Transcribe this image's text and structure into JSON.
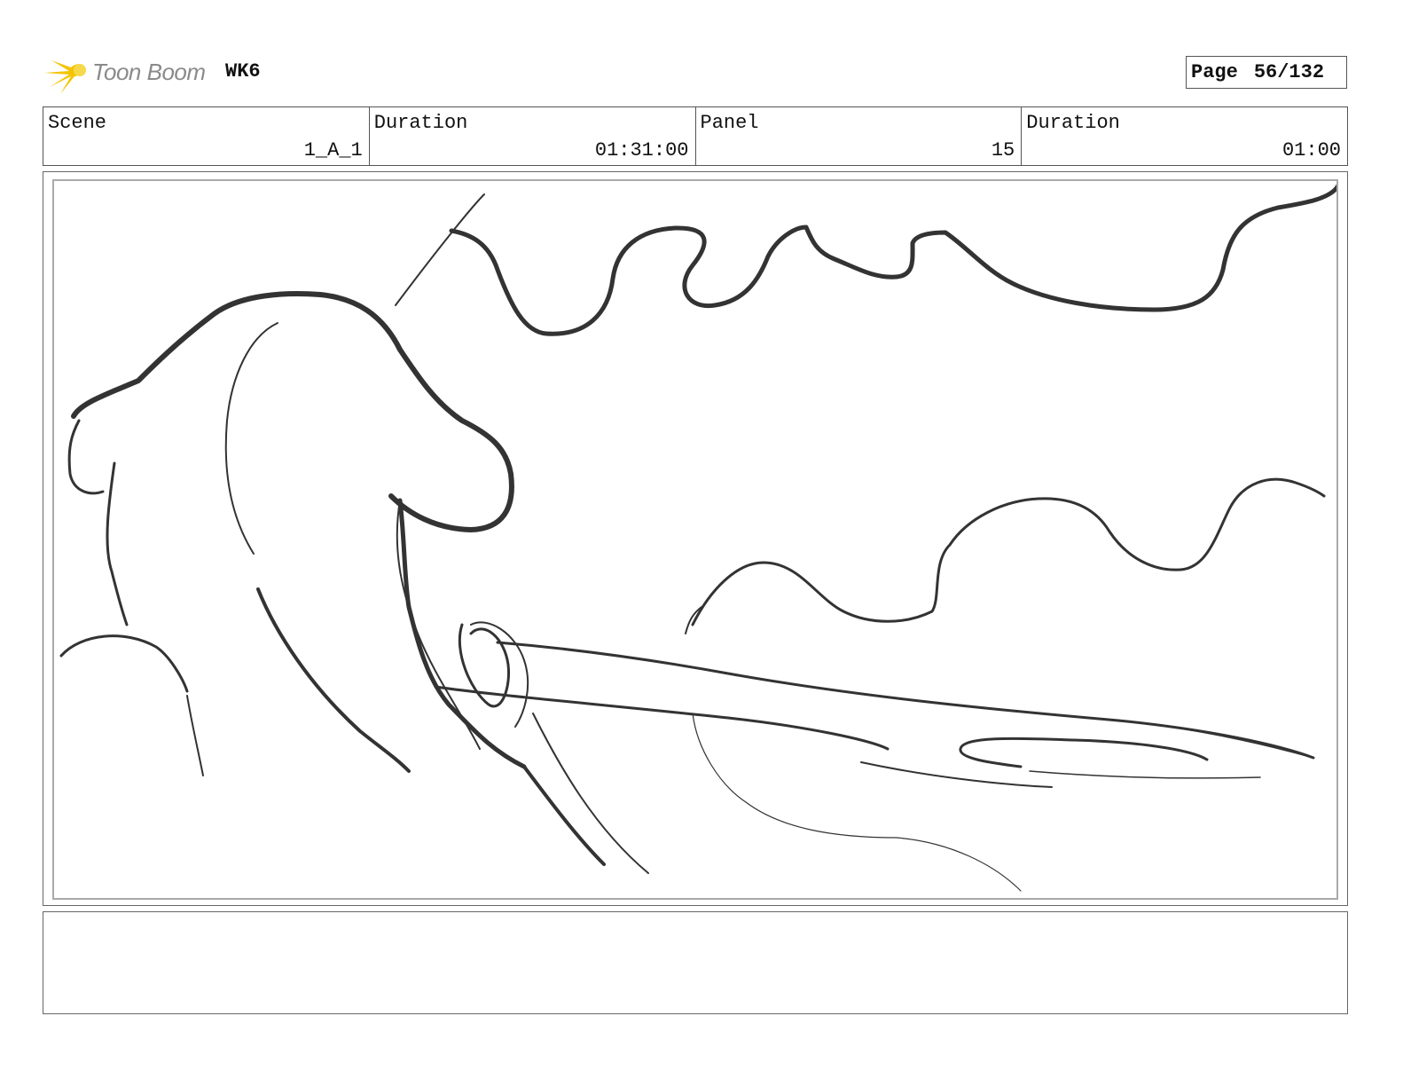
{
  "header": {
    "logo_text": "Toon Boom",
    "project": "WK6",
    "page_label": "Page",
    "page_number": "56/132"
  },
  "info": {
    "scene_label": "Scene",
    "scene_value": "1_A_1",
    "duration_label": "Duration",
    "duration_value": "01:31:00",
    "panel_label": "Panel",
    "panel_value": "15",
    "panel_duration_label": "Duration",
    "panel_duration_value": "01:00"
  },
  "notes": {
    "text": ""
  },
  "colors": {
    "logo_star": "#f5c400",
    "logo_text": "#8a8a8a",
    "sketch_stroke": "#333333"
  }
}
